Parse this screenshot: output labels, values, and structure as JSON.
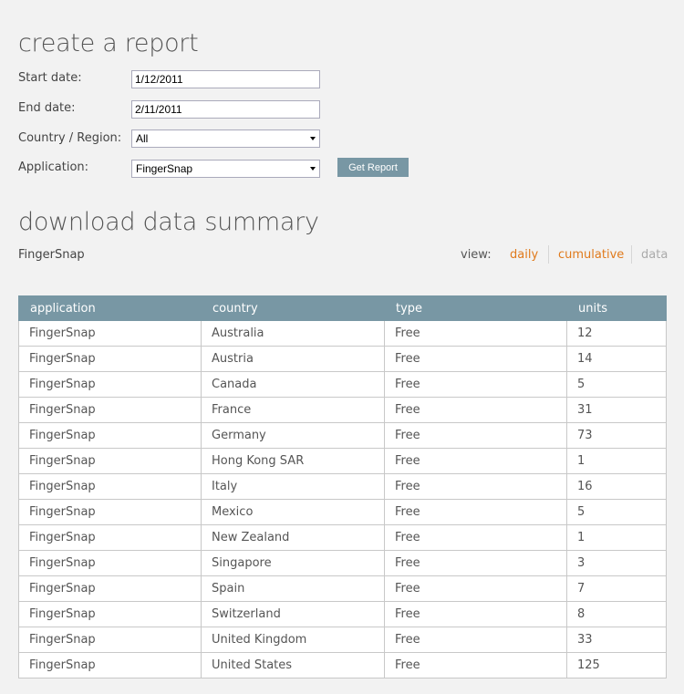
{
  "report": {
    "title": "create a report",
    "start_date_label": "Start date:",
    "start_date_value": "1/12/2011",
    "end_date_label": "End date:",
    "end_date_value": "2/11/2011",
    "country_label": "Country / Region:",
    "country_value": "All",
    "application_label": "Application:",
    "application_value": "FingerSnap",
    "get_report_label": "Get Report"
  },
  "summary": {
    "title": "download data summary",
    "app_name": "FingerSnap",
    "view_label": "view:",
    "view_daily": "daily",
    "view_cumulative": "cumulative",
    "view_data": "data",
    "columns": [
      "application",
      "country",
      "type",
      "units"
    ],
    "rows": [
      [
        "FingerSnap",
        "Australia",
        "Free",
        "12"
      ],
      [
        "FingerSnap",
        "Austria",
        "Free",
        "14"
      ],
      [
        "FingerSnap",
        "Canada",
        "Free",
        "5"
      ],
      [
        "FingerSnap",
        "France",
        "Free",
        "31"
      ],
      [
        "FingerSnap",
        "Germany",
        "Free",
        "73"
      ],
      [
        "FingerSnap",
        "Hong Kong SAR",
        "Free",
        "1"
      ],
      [
        "FingerSnap",
        "Italy",
        "Free",
        "16"
      ],
      [
        "FingerSnap",
        "Mexico",
        "Free",
        "5"
      ],
      [
        "FingerSnap",
        "New Zealand",
        "Free",
        "1"
      ],
      [
        "FingerSnap",
        "Singapore",
        "Free",
        "3"
      ],
      [
        "FingerSnap",
        "Spain",
        "Free",
        "7"
      ],
      [
        "FingerSnap",
        "Switzerland",
        "Free",
        "8"
      ],
      [
        "FingerSnap",
        "United Kingdom",
        "Free",
        "33"
      ],
      [
        "FingerSnap",
        "United States",
        "Free",
        "125"
      ]
    ]
  },
  "colors": {
    "accent": "#7897a4",
    "link": "#e07a1c",
    "link_disabled": "#aaaaaa",
    "background": "#f2f2f2"
  },
  "icons": {
    "select_arrow": "chevron-down-icon"
  }
}
